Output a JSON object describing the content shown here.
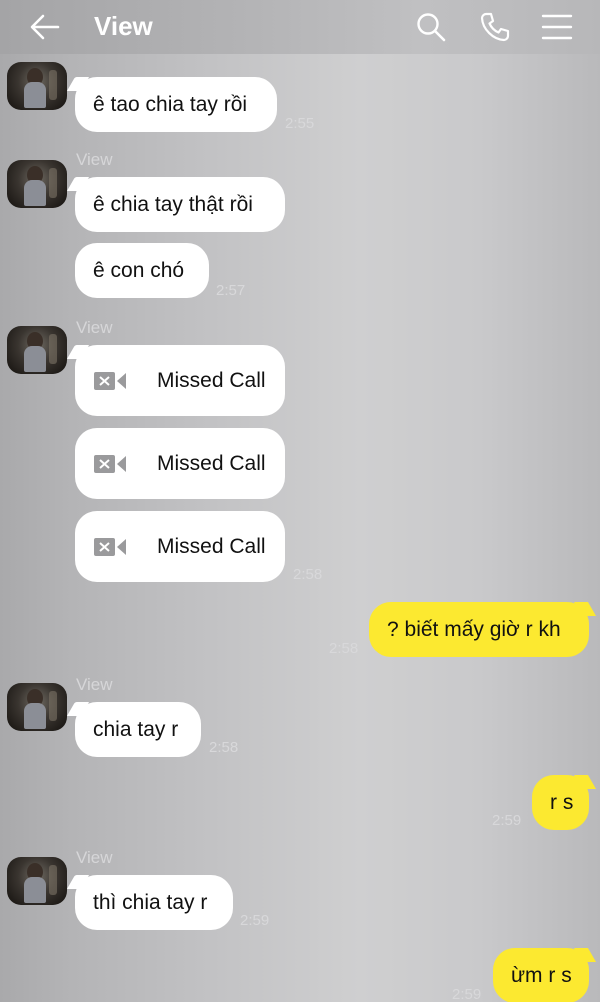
{
  "header": {
    "title": "View",
    "icons": [
      "back-arrow-icon",
      "search-icon",
      "phone-icon",
      "menu-icon"
    ]
  },
  "messages": {
    "m1": {
      "text": "ê tao chia tay rồi",
      "time": "2:55"
    },
    "m2": {
      "sender": "View",
      "text": "ê chia tay thật rồi"
    },
    "m3": {
      "text": "ê con chó",
      "time": "2:57"
    },
    "m4": {
      "sender": "View",
      "call1": "Missed Call",
      "call2": "Missed Call",
      "call3": "Missed Call",
      "time": "2:58"
    },
    "m5": {
      "text": "? biết mấy giờ r kh",
      "time": "2:58"
    },
    "m6": {
      "sender": "View",
      "text": "chia tay r",
      "time": "2:58"
    },
    "m7": {
      "text": "r s",
      "time": "2:59"
    },
    "m8": {
      "sender": "View",
      "text": "thì chia tay r",
      "time": "2:59"
    },
    "m9": {
      "text": "ừm r s",
      "time": "2:59"
    }
  },
  "colors": {
    "outgoing_bubble": "#fce930",
    "incoming_bubble": "#ffffff",
    "timestamp": "#d8d8da"
  }
}
